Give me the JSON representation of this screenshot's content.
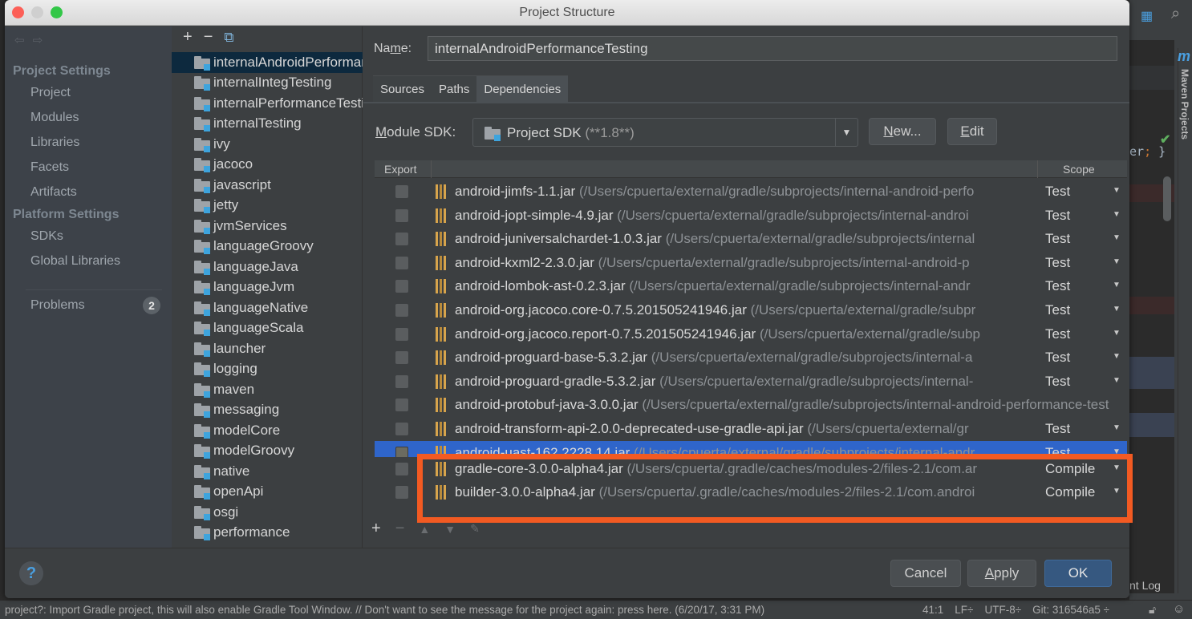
{
  "window": {
    "title": "Project Structure"
  },
  "nav": {
    "sections": [
      {
        "label": "Project Settings",
        "items": [
          "Project",
          "Modules",
          "Libraries",
          "Facets",
          "Artifacts"
        ]
      },
      {
        "label": "Platform Settings",
        "items": [
          "SDKs",
          "Global Libraries"
        ]
      }
    ],
    "problems": {
      "label": "Problems",
      "count": "2"
    }
  },
  "tree": {
    "toolbar": {
      "add": "+",
      "remove": "−",
      "copy": "copy"
    },
    "modules": [
      "internalAndroidPerformanceTesting",
      "internalIntegTesting",
      "internalPerformanceTesting",
      "internalTesting",
      "ivy",
      "jacoco",
      "javascript",
      "jetty",
      "jvmServices",
      "languageGroovy",
      "languageJava",
      "languageJvm",
      "languageNative",
      "languageScala",
      "launcher",
      "logging",
      "maven",
      "messaging",
      "modelCore",
      "modelGroovy",
      "native",
      "openApi",
      "osgi",
      "performance"
    ],
    "selected_index": 0
  },
  "module": {
    "name_label": "Name:",
    "name_value": "internalAndroidPerformanceTesting",
    "tabs": [
      {
        "label": "Sources",
        "active": false
      },
      {
        "label": "Paths",
        "active": false
      },
      {
        "label": "Dependencies",
        "active": true
      }
    ],
    "sdk_label": "Module SDK:",
    "sdk_value": "Project SDK",
    "sdk_version": "(**1.8**)",
    "new_button": "New...",
    "edit_button": "Edit"
  },
  "dependencies": {
    "columns": {
      "export": "Export",
      "scope": "Scope"
    },
    "rows": [
      {
        "name": "android-jimfs-1.1.jar",
        "path": "(/Users/cpuerta/external/gradle/subprojects/internal-android-perfo",
        "scope": "Test",
        "exported": false
      },
      {
        "name": "android-jopt-simple-4.9.jar",
        "path": "(/Users/cpuerta/external/gradle/subprojects/internal-androi",
        "scope": "Test",
        "exported": false
      },
      {
        "name": "android-juniversalchardet-1.0.3.jar",
        "path": "(/Users/cpuerta/external/gradle/subprojects/internal",
        "scope": "Test",
        "exported": false
      },
      {
        "name": "android-kxml2-2.3.0.jar",
        "path": "(/Users/cpuerta/external/gradle/subprojects/internal-android-p",
        "scope": "Test",
        "exported": false
      },
      {
        "name": "android-lombok-ast-0.2.3.jar",
        "path": "(/Users/cpuerta/external/gradle/subprojects/internal-andr",
        "scope": "Test",
        "exported": false
      },
      {
        "name": "android-org.jacoco.core-0.7.5.201505241946.jar",
        "path": "(/Users/cpuerta/external/gradle/subpr",
        "scope": "Test",
        "exported": false
      },
      {
        "name": "android-org.jacoco.report-0.7.5.201505241946.jar",
        "path": "(/Users/cpuerta/external/gradle/subp",
        "scope": "Test",
        "exported": false
      },
      {
        "name": "android-proguard-base-5.3.2.jar",
        "path": "(/Users/cpuerta/external/gradle/subprojects/internal-a",
        "scope": "Test",
        "exported": false
      },
      {
        "name": "android-proguard-gradle-5.3.2.jar",
        "path": "(/Users/cpuerta/external/gradle/subprojects/internal-",
        "scope": "Test",
        "exported": false
      },
      {
        "name": "android-protobuf-java-3.0.0.jar",
        "path": "(/Users/cpuerta/external/gradle/subprojects/internal-android-performance-test",
        "scope": "",
        "exported": false
      },
      {
        "name": "android-transform-api-2.0.0-deprecated-use-gradle-api.jar",
        "path": "(/Users/cpuerta/external/gr",
        "scope": "Test",
        "exported": false
      },
      {
        "name": "android-uast-162.2228.14.jar",
        "path": "(/Users/cpuerta/external/gradle/subprojects/internal-andr",
        "scope": "Test",
        "exported": false
      },
      {
        "name": "gradle-core-3.0.0-alpha4.jar",
        "path": "(/Users/cpuerta/.gradle/caches/modules-2/files-2.1/com.ar",
        "scope": "Compile",
        "exported": false
      },
      {
        "name": "builder-3.0.0-alpha4.jar",
        "path": "(/Users/cpuerta/.gradle/caches/modules-2/files-2.1/com.androi",
        "scope": "Compile",
        "exported": false
      }
    ],
    "selected_index": 11,
    "highlighted_rows": [
      12,
      13
    ],
    "highlight_color": "#f25a22",
    "toolbar": {
      "add": "+",
      "remove": "−",
      "up": "▲",
      "down": "▼",
      "edit": "✎"
    }
  },
  "footer": {
    "help": "?",
    "cancel": "Cancel",
    "apply": "Apply",
    "ok": "OK"
  },
  "ide": {
    "code_fragment": "er",
    "code_semicolon": ";",
    "code_brace": "}",
    "maven_tab": "Maven Projects",
    "event_log": "nt Log"
  },
  "status_bar": {
    "message": "project?: Import Gradle project, this will also enable Gradle Tool Window. // Don't want to see the message for the project again: press here. (6/20/17, 3:31 PM)",
    "position": "41:1",
    "line_sep": "LF÷",
    "encoding": "UTF-8÷",
    "git": "Git: 316546a5 ÷"
  },
  "colors": {
    "accent_blue": "#2f65ca",
    "ok_button": "#365880",
    "highlight_box": "#f25a22",
    "tree_selection": "#0d293e"
  }
}
